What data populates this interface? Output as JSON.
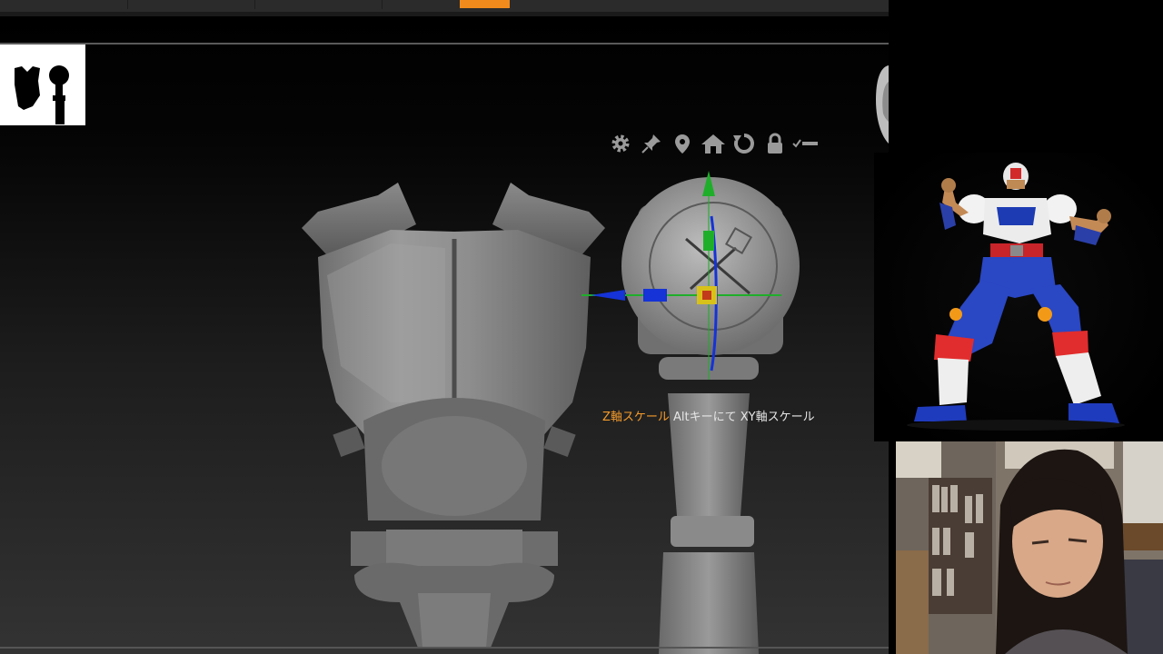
{
  "toolbar": {
    "icons": [
      "gear-icon",
      "pin-icon",
      "location-icon",
      "home-icon",
      "reset-icon",
      "lock-icon",
      "collapse-icon"
    ]
  },
  "hint": {
    "highlight": "Z軸スケール",
    "rest": " Altキーにて XY軸スケール"
  },
  "colors": {
    "accent_orange": "#f08a1c",
    "gizmo_green": "#1fae2a",
    "gizmo_blue": "#1533d6",
    "gizmo_yellow": "#d8c21a",
    "model_gray": "#8a8a8a"
  }
}
